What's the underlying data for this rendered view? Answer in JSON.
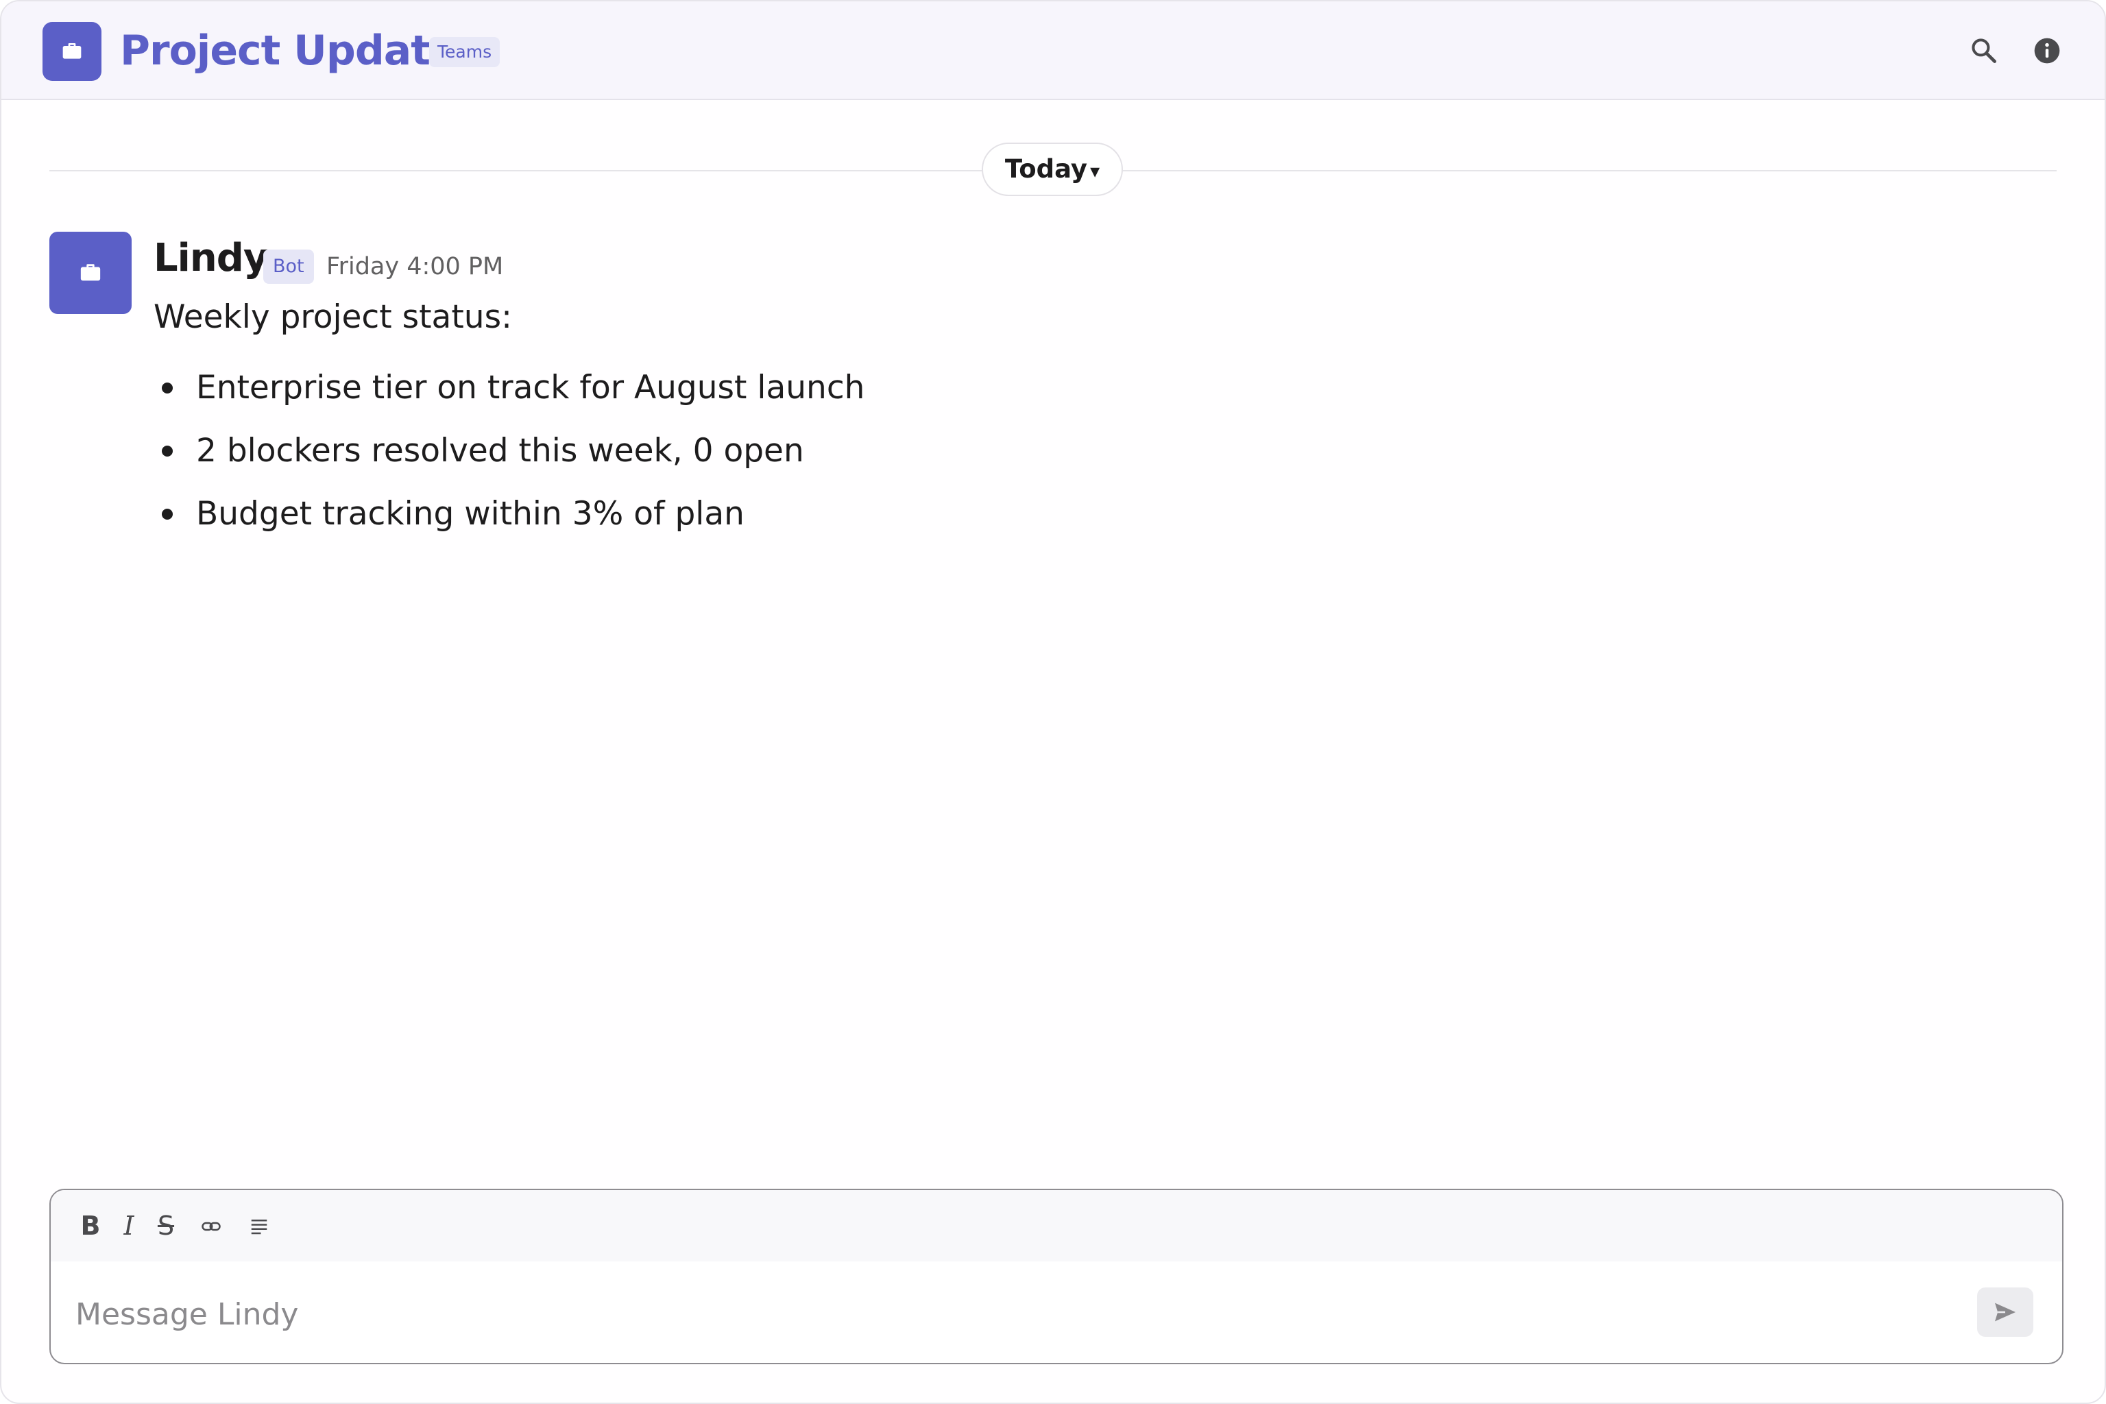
{
  "header": {
    "channel_title": "Project Updates",
    "badge": "Teams",
    "channel_icon": "briefcase-icon",
    "search_icon": "search-icon",
    "info_icon": "info-icon"
  },
  "divider": {
    "label": "Today",
    "caret": "▾"
  },
  "message": {
    "sender": "Lindy",
    "badge": "Bot",
    "timestamp": "Friday 4:00 PM",
    "avatar_icon": "briefcase-icon",
    "intro": "Weekly project status:",
    "bullets": [
      "Enterprise tier on track for August launch",
      "2 blockers resolved this week, 0 open",
      "Budget tracking within 3% of plan"
    ]
  },
  "composer": {
    "tools": {
      "bold": "B",
      "italic": "I",
      "strike": "S"
    },
    "placeholder": "Message Lindy",
    "value": ""
  },
  "colors": {
    "accent": "#5b5fc7",
    "header_bg": "#f7f5fc",
    "badge_bg": "#e6e6f6",
    "text": "#1d1c1d",
    "muted": "#616061"
  }
}
